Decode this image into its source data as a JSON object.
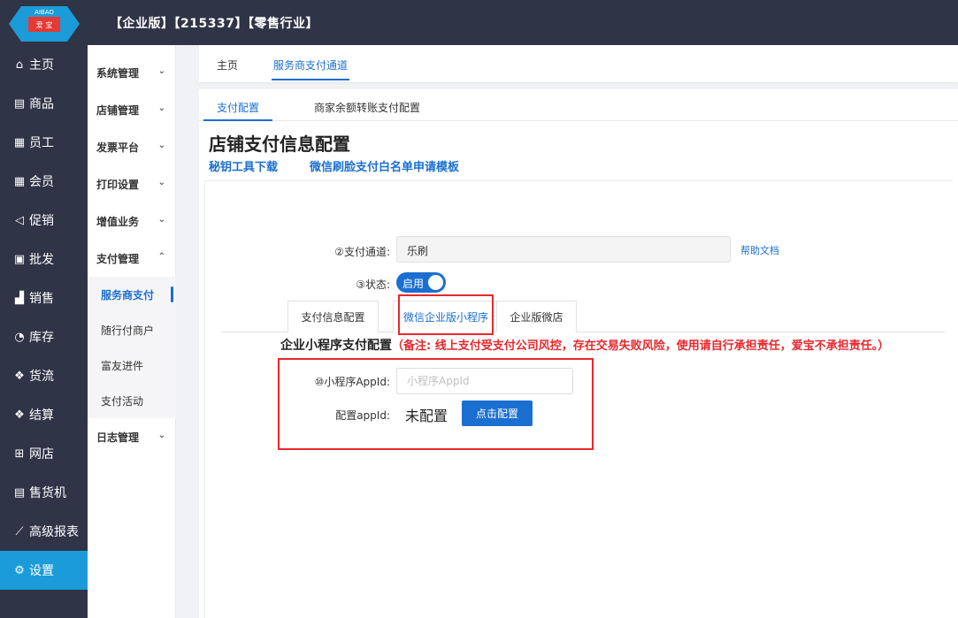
{
  "brand": {
    "logo_text_top": "AIBAO",
    "logo_text_bottom": "爱 宝",
    "logo_color": "#1b9cd8"
  },
  "header": {
    "title": "【企业版】【215337】【零售行业】"
  },
  "sidebar": {
    "items": [
      {
        "label": "主页",
        "icon": "home-icon",
        "glyph": "⌂"
      },
      {
        "label": "商品",
        "icon": "goods-icon",
        "glyph": "▤"
      },
      {
        "label": "员工",
        "icon": "staff-icon",
        "glyph": "▦"
      },
      {
        "label": "会员",
        "icon": "member-icon",
        "glyph": "▦"
      },
      {
        "label": "促销",
        "icon": "promotion-icon",
        "glyph": "◁"
      },
      {
        "label": "批发",
        "icon": "wholesale-icon",
        "glyph": "▣"
      },
      {
        "label": "销售",
        "icon": "sales-icon",
        "glyph": "▟"
      },
      {
        "label": "库存",
        "icon": "inventory-icon",
        "glyph": "◔"
      },
      {
        "label": "货流",
        "icon": "logistics-icon",
        "glyph": "❖"
      },
      {
        "label": "结算",
        "icon": "settlement-icon",
        "glyph": "❖"
      },
      {
        "label": "网店",
        "icon": "gift-icon",
        "glyph": "⊞"
      },
      {
        "label": "售货机",
        "icon": "vending-icon",
        "glyph": "▤"
      },
      {
        "label": "高级报表",
        "icon": "report-icon",
        "glyph": "⟋"
      },
      {
        "label": "设置",
        "icon": "settings-icon",
        "glyph": "⚙"
      }
    ],
    "active_color": "#1b9cd8"
  },
  "submenu": {
    "groups": [
      {
        "label": "系统管理",
        "chevron": "⌄"
      },
      {
        "label": "店铺管理",
        "chevron": "⌄"
      },
      {
        "label": "发票平台",
        "chevron": "⌄"
      },
      {
        "label": "打印设置",
        "chevron": "⌄"
      },
      {
        "label": "增值业务",
        "chevron": "⌄"
      },
      {
        "label": "支付管理",
        "chevron": "⌃"
      }
    ],
    "pay_items": [
      {
        "label": "服务商支付"
      },
      {
        "label": "随行付商户"
      },
      {
        "label": "富友进件"
      },
      {
        "label": "支付活动"
      }
    ],
    "log_group": {
      "label": "日志管理",
      "chevron": "⌄"
    }
  },
  "tabs": {
    "home": "主页",
    "current": "服务商支付通道"
  },
  "subtabs": {
    "pay_config": "支付配置",
    "balance_config": "商家余额转账支付配置"
  },
  "page": {
    "title": "店铺支付信息配置",
    "link_key_tool": "秘钥工具下载",
    "link_whitelist": "微信刷脸支付白名单申请模板"
  },
  "form": {
    "channel_label": "②支付通道:",
    "channel_value": "乐刷",
    "help_link": "帮助文档",
    "status_label": "③状态:",
    "status_value": "启用",
    "status_on": true
  },
  "pay_tabs": {
    "info": "支付信息配置",
    "wechat_mini": "微信企业版小程序",
    "wechat_shop": "企业版微店"
  },
  "mini_section": {
    "title": "企业小程序支付配置",
    "warning": "（备注: 线上支付受支付公司风控，存在交易失败风险，使用请自行承担责任，爱宝不承担责任。）",
    "appid_label": "⑩小程序AppId:",
    "appid_value": "",
    "appid_placeholder": "小程序AppId",
    "config_label": "配置appId:",
    "config_status": "未配置",
    "config_button": "点击配置"
  },
  "colors": {
    "primary": "#1b6fd1",
    "highlight_frame": "#e8272c",
    "dark_nav": "#2f3447"
  }
}
